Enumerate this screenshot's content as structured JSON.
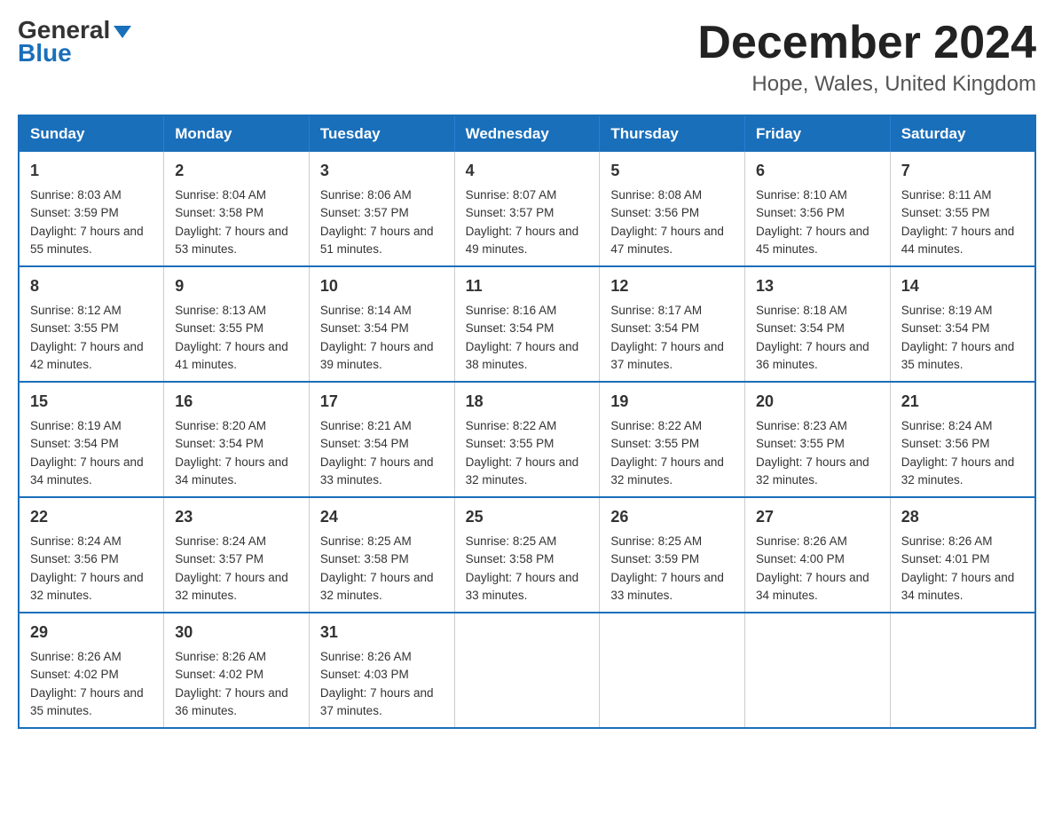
{
  "logo": {
    "part1": "General",
    "part2": "Blue"
  },
  "header": {
    "month": "December 2024",
    "location": "Hope, Wales, United Kingdom"
  },
  "weekdays": [
    "Sunday",
    "Monday",
    "Tuesday",
    "Wednesday",
    "Thursday",
    "Friday",
    "Saturday"
  ],
  "weeks": [
    [
      {
        "day": "1",
        "sunrise": "8:03 AM",
        "sunset": "3:59 PM",
        "daylight": "7 hours and 55 minutes."
      },
      {
        "day": "2",
        "sunrise": "8:04 AM",
        "sunset": "3:58 PM",
        "daylight": "7 hours and 53 minutes."
      },
      {
        "day": "3",
        "sunrise": "8:06 AM",
        "sunset": "3:57 PM",
        "daylight": "7 hours and 51 minutes."
      },
      {
        "day": "4",
        "sunrise": "8:07 AM",
        "sunset": "3:57 PM",
        "daylight": "7 hours and 49 minutes."
      },
      {
        "day": "5",
        "sunrise": "8:08 AM",
        "sunset": "3:56 PM",
        "daylight": "7 hours and 47 minutes."
      },
      {
        "day": "6",
        "sunrise": "8:10 AM",
        "sunset": "3:56 PM",
        "daylight": "7 hours and 45 minutes."
      },
      {
        "day": "7",
        "sunrise": "8:11 AM",
        "sunset": "3:55 PM",
        "daylight": "7 hours and 44 minutes."
      }
    ],
    [
      {
        "day": "8",
        "sunrise": "8:12 AM",
        "sunset": "3:55 PM",
        "daylight": "7 hours and 42 minutes."
      },
      {
        "day": "9",
        "sunrise": "8:13 AM",
        "sunset": "3:55 PM",
        "daylight": "7 hours and 41 minutes."
      },
      {
        "day": "10",
        "sunrise": "8:14 AM",
        "sunset": "3:54 PM",
        "daylight": "7 hours and 39 minutes."
      },
      {
        "day": "11",
        "sunrise": "8:16 AM",
        "sunset": "3:54 PM",
        "daylight": "7 hours and 38 minutes."
      },
      {
        "day": "12",
        "sunrise": "8:17 AM",
        "sunset": "3:54 PM",
        "daylight": "7 hours and 37 minutes."
      },
      {
        "day": "13",
        "sunrise": "8:18 AM",
        "sunset": "3:54 PM",
        "daylight": "7 hours and 36 minutes."
      },
      {
        "day": "14",
        "sunrise": "8:19 AM",
        "sunset": "3:54 PM",
        "daylight": "7 hours and 35 minutes."
      }
    ],
    [
      {
        "day": "15",
        "sunrise": "8:19 AM",
        "sunset": "3:54 PM",
        "daylight": "7 hours and 34 minutes."
      },
      {
        "day": "16",
        "sunrise": "8:20 AM",
        "sunset": "3:54 PM",
        "daylight": "7 hours and 34 minutes."
      },
      {
        "day": "17",
        "sunrise": "8:21 AM",
        "sunset": "3:54 PM",
        "daylight": "7 hours and 33 minutes."
      },
      {
        "day": "18",
        "sunrise": "8:22 AM",
        "sunset": "3:55 PM",
        "daylight": "7 hours and 32 minutes."
      },
      {
        "day": "19",
        "sunrise": "8:22 AM",
        "sunset": "3:55 PM",
        "daylight": "7 hours and 32 minutes."
      },
      {
        "day": "20",
        "sunrise": "8:23 AM",
        "sunset": "3:55 PM",
        "daylight": "7 hours and 32 minutes."
      },
      {
        "day": "21",
        "sunrise": "8:24 AM",
        "sunset": "3:56 PM",
        "daylight": "7 hours and 32 minutes."
      }
    ],
    [
      {
        "day": "22",
        "sunrise": "8:24 AM",
        "sunset": "3:56 PM",
        "daylight": "7 hours and 32 minutes."
      },
      {
        "day": "23",
        "sunrise": "8:24 AM",
        "sunset": "3:57 PM",
        "daylight": "7 hours and 32 minutes."
      },
      {
        "day": "24",
        "sunrise": "8:25 AM",
        "sunset": "3:58 PM",
        "daylight": "7 hours and 32 minutes."
      },
      {
        "day": "25",
        "sunrise": "8:25 AM",
        "sunset": "3:58 PM",
        "daylight": "7 hours and 33 minutes."
      },
      {
        "day": "26",
        "sunrise": "8:25 AM",
        "sunset": "3:59 PM",
        "daylight": "7 hours and 33 minutes."
      },
      {
        "day": "27",
        "sunrise": "8:26 AM",
        "sunset": "4:00 PM",
        "daylight": "7 hours and 34 minutes."
      },
      {
        "day": "28",
        "sunrise": "8:26 AM",
        "sunset": "4:01 PM",
        "daylight": "7 hours and 34 minutes."
      }
    ],
    [
      {
        "day": "29",
        "sunrise": "8:26 AM",
        "sunset": "4:02 PM",
        "daylight": "7 hours and 35 minutes."
      },
      {
        "day": "30",
        "sunrise": "8:26 AM",
        "sunset": "4:02 PM",
        "daylight": "7 hours and 36 minutes."
      },
      {
        "day": "31",
        "sunrise": "8:26 AM",
        "sunset": "4:03 PM",
        "daylight": "7 hours and 37 minutes."
      },
      null,
      null,
      null,
      null
    ]
  ],
  "labels": {
    "sunrise": "Sunrise: ",
    "sunset": "Sunset: ",
    "daylight": "Daylight: "
  }
}
